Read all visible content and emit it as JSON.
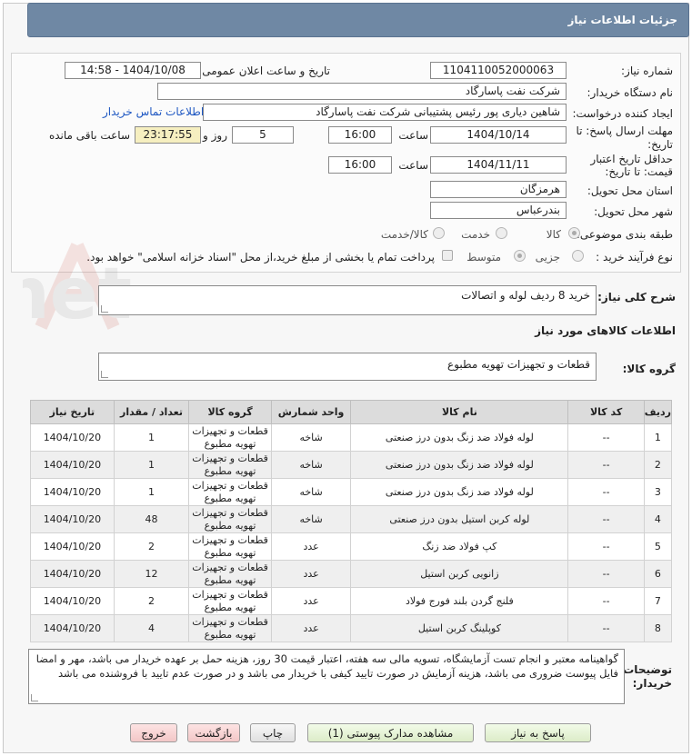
{
  "header": {
    "title": "جزئیات اطلاعات نیاز"
  },
  "form": {
    "need_number_label": "شماره نیاز:",
    "need_number": "1104110052000063",
    "announce_label": "تاریخ و ساعت اعلان عمومی:",
    "announce_value": "1404/10/08 - 14:58",
    "buyer_org_label": "نام دستگاه خریدار:",
    "buyer_org": "شرکت نفت پاسارگاد",
    "requester_label": "ایجاد کننده درخواست:",
    "requester": "شاهین دیاری پور رئیس پشتیبانی شرکت نفت پاسارگاد",
    "contact_link": "اطلاعات تماس خریدار",
    "reply_deadline_label_1": "مهلت ارسال پاسخ: تا",
    "reply_deadline_label_2": "تاریخ:",
    "reply_date": "1404/10/14",
    "time_label": "ساعت",
    "reply_time": "16:00",
    "days_value": "5",
    "days_and_label": "روز و",
    "remaining_time": "23:17:55",
    "remaining_label": "ساعت باقی مانده",
    "validity_label_1": "حداقل تاریخ اعتبار",
    "validity_label_2": "قیمت: تا تاریخ:",
    "validity_date": "1404/11/11",
    "validity_time": "16:00",
    "province_label": "استان محل تحویل:",
    "province": "هرمزگان",
    "city_label": "شهر محل تحویل:",
    "city": "بندرعباس",
    "category_label": "طبقه بندی موضوعی:",
    "category_options": [
      "کالا",
      "خدمت",
      "کالا/خدمت"
    ],
    "process_label": "نوع فرآیند خرید :",
    "process_options": [
      "جزیی",
      "متوسط"
    ],
    "payment_note": "پرداخت تمام یا بخشی از مبلغ خرید،از محل \"اسناد خزانه اسلامی\" خواهد بود.",
    "desc_label": "شرح کلی نیاز:",
    "desc_value": "خرید 8 ردیف لوله و اتصالات",
    "goods_info_label": "اطلاعات کالاهای مورد نیاز",
    "goods_group_label": "گروه کالا:",
    "goods_group_value": "قطعات و تجهیزات تهویه مطبوع"
  },
  "table": {
    "headers": [
      "ردیف",
      "کد کالا",
      "نام کالا",
      "واحد شمارش",
      "گروه کالا",
      "تعداد / مقدار",
      "تاریخ نیاز"
    ],
    "rows": [
      [
        "1",
        "--",
        "لوله فولاد ضد زنگ بدون درز صنعتی",
        "شاخه",
        "قطعات و تجهیزات تهویه مطبوع",
        "1",
        "1404/10/20"
      ],
      [
        "2",
        "--",
        "لوله فولاد ضد زنگ بدون درز صنعتی",
        "شاخه",
        "قطعات و تجهیزات تهویه مطبوع",
        "1",
        "1404/10/20"
      ],
      [
        "3",
        "--",
        "لوله فولاد ضد زنگ بدون درز صنعتی",
        "شاخه",
        "قطعات و تجهیزات تهویه مطبوع",
        "1",
        "1404/10/20"
      ],
      [
        "4",
        "--",
        "لوله کربن استیل بدون درز صنعتی",
        "شاخه",
        "قطعات و تجهیزات تهویه مطبوع",
        "48",
        "1404/10/20"
      ],
      [
        "5",
        "--",
        "کپ فولاد ضد زنگ",
        "عدد",
        "قطعات و تجهیزات تهویه مطبوع",
        "2",
        "1404/10/20"
      ],
      [
        "6",
        "--",
        "زانویی کربن استیل",
        "عدد",
        "قطعات و تجهیزات تهویه مطبوع",
        "12",
        "1404/10/20"
      ],
      [
        "7",
        "--",
        "فلنج گردن بلند فورج فولاد",
        "عدد",
        "قطعات و تجهیزات تهویه مطبوع",
        "2",
        "1404/10/20"
      ],
      [
        "8",
        "--",
        "کوپلینگ کربن استیل",
        "عدد",
        "قطعات و تجهیزات تهویه مطبوع",
        "4",
        "1404/10/20"
      ]
    ]
  },
  "buyer_notes": {
    "label_1": "توضیحات",
    "label_2": "خریدار:",
    "text": "گواهینامه معتبر و انجام تست آزمایشگاه، تسویه مالی سه هفته، اعتبار قیمت 30 روز، هزینه حمل بر عهده خریدار می باشد، مهر و امضا فایل پیوست ضروری می باشد، هزینه آزمایش در صورت تایید کیفی با خریدار می باشد و در صورت عدم تایید با فروشنده می باشد"
  },
  "buttons": {
    "reply": "پاسخ به نیاز",
    "attachments": "مشاهده مدارک پیوستی (1)",
    "print": "چاپ",
    "back": "بازگشت",
    "exit": "خروج"
  },
  "watermark": {
    "text": "AriaTender.net"
  },
  "colors": {
    "title_bar": "#6f88a4",
    "link": "#1e57c2",
    "highlight": "#f6efc0"
  }
}
